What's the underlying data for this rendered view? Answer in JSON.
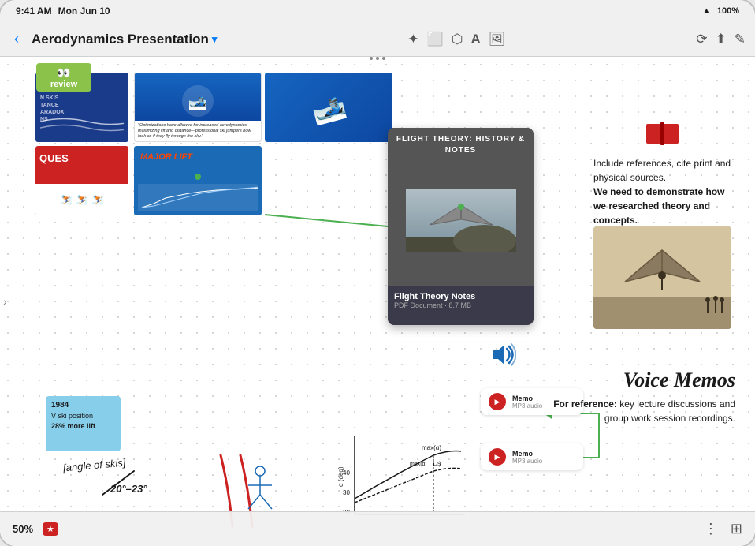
{
  "status_bar": {
    "time": "9:41 AM",
    "date": "Mon Jun 10",
    "wifi": "WiFi",
    "battery": "100%"
  },
  "nav": {
    "back_label": "‹",
    "title": "Aerodynamics Presentation",
    "chevron": "▾",
    "dots": "•••",
    "icons": {
      "edit": "✎",
      "share": "⬆",
      "history": "⟳"
    }
  },
  "toolbar": {
    "icon1": "✦",
    "icon2": "⬜",
    "icon3": "⬡",
    "icon4": "A",
    "icon5": "⬛"
  },
  "canvas": {
    "review_label": "review",
    "slide1_text": "NS\nAMICS\nN SKIS\nTANCE\nARADOX\nNS",
    "slide2_quote": "\"Optimizations have allowed for increased aerodynamics, maximizing lift and distance—professional ski jumpers now look as if they fly through the sky.\"",
    "slide4_label": "QUES",
    "slide5_label": "MAJOR LIFT",
    "flight_theory_title": "FLIGHT THEORY:\nHISTORY & NOTES",
    "flight_theory_file": "Flight Theory Notes",
    "flight_theory_type": "PDF Document · 8.7 MB",
    "reference_text": "Include references, cite print and physical sources.",
    "reference_bold": "We need to demonstrate how we researched theory and concepts.",
    "sticky_year": "1984",
    "sticky_position": "V ski position",
    "sticky_lift": "28% more lift",
    "voice_memos_title": "Voice Memos",
    "voice_memos_bold": "For reference:",
    "voice_memos_text": " key lecture discussions and group work session recordings.",
    "memo1_label": "Memo",
    "memo1_type": "MP3 audio",
    "memo2_label": "Memo",
    "memo2_type": "MP3 audio",
    "angle_label": "[angle of skis]",
    "angle_value": "20°–23°",
    "zoom": "50%"
  },
  "bottom_bar": {
    "zoom_label": "50%",
    "star_icon": "★",
    "grid_icon": "⊞",
    "hierarchy_icon": "⋮"
  }
}
